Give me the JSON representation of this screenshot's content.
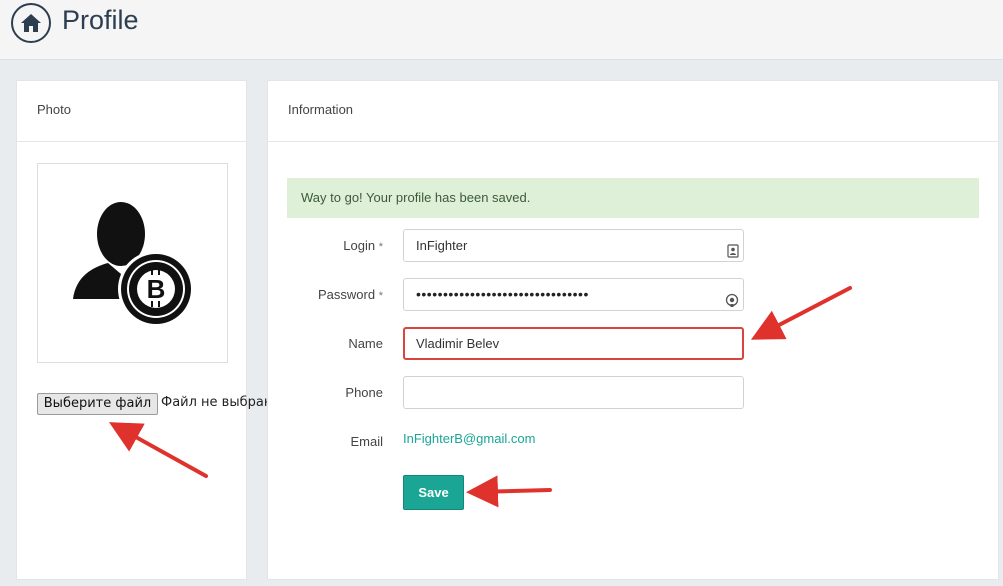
{
  "header": {
    "title": "Profile",
    "home_icon": "home-icon"
  },
  "photo_panel": {
    "title": "Photo",
    "avatar_icon": "user-bitcoin-icon",
    "file_button_label": "Выберите файл",
    "file_status": "Файл не выбран"
  },
  "info_panel": {
    "title": "Information",
    "alert": "Way to go! Your profile has been saved.",
    "fields": {
      "login": {
        "label": "Login",
        "required_mark": "*",
        "value": "InFighter",
        "icon": "contact-card-icon"
      },
      "password": {
        "label": "Password",
        "required_mark": "*",
        "value": "••••••••••••••••••••••••••••••••",
        "icon": "eye-icon"
      },
      "name": {
        "label": "Name",
        "value": "Vladimir Belev"
      },
      "phone": {
        "label": "Phone",
        "value": ""
      },
      "email": {
        "label": "Email",
        "value": "InFighterB@gmail.com"
      }
    },
    "save_label": "Save"
  },
  "colors": {
    "accent": "#1aa594",
    "alert_bg": "#dff0d8",
    "active_border": "#d9443c",
    "annotation_arrow": "#e0322d"
  }
}
